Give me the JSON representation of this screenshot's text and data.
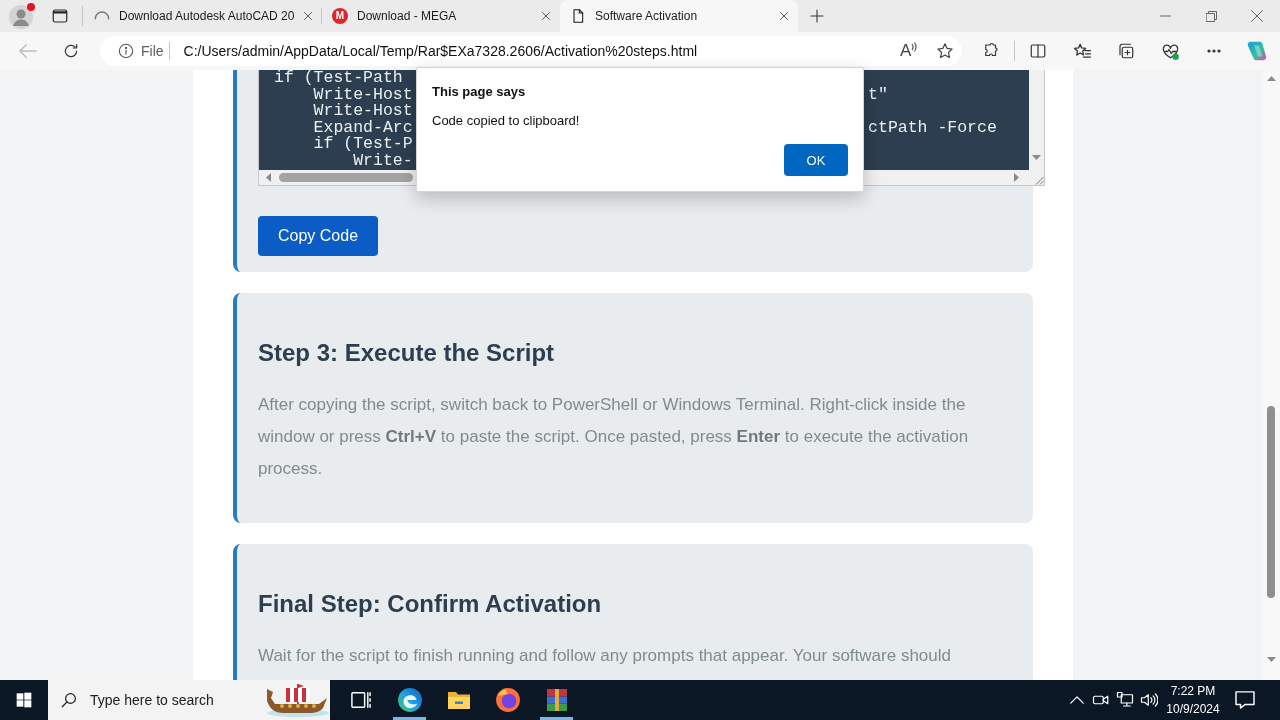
{
  "browser": {
    "tabs": [
      {
        "kind": "spinner",
        "title": "Download Autodesk AutoCAD 20",
        "selected": false
      },
      {
        "kind": "letter",
        "icon_letter": "M",
        "title": "Download - MEGA",
        "selected": false
      },
      {
        "kind": "page",
        "title": "Software Activation",
        "selected": true
      }
    ],
    "back_button": {
      "disabled": true
    },
    "address_bar": {
      "scheme": "File",
      "url": "C:/Users/admin/AppData/Local/Temp/Rar$EXa7328.2606/Activation%20steps.html",
      "read_aloud_glyph": "A"
    }
  },
  "page": {
    "code_block": {
      "lines": [
        {
          "text": "if (Test-Path"
        },
        {
          "text": "    Write-Host",
          "tail": "t\""
        },
        {
          "text": "    Write-Host"
        },
        {
          "text": "    Expand-Arc",
          "tail": "ctPath -Force"
        },
        {
          "text": "    if (Test-P"
        },
        {
          "text": "        Write-"
        }
      ]
    },
    "copy_button": "Copy Code",
    "steps": [
      {
        "heading": "Step 3: Execute the Script",
        "body": "After copying the script, switch back to PowerShell or Windows Terminal. Right-click inside the window or press **Ctrl+V** to paste the script. Once pasted, press **Enter** to execute the activation process."
      },
      {
        "heading": "Final Step: Confirm Activation",
        "body": "Wait for the script to finish running and follow any prompts that appear. Your software should"
      }
    ]
  },
  "dialog": {
    "title": "This page says",
    "message": "Code copied to clipboard!",
    "button": "OK"
  },
  "taskbar": {
    "search": {
      "placeholder": "Type here to search"
    },
    "apps": [
      {
        "kind": "edge",
        "running": true
      },
      {
        "kind": "explorer",
        "running": false
      },
      {
        "kind": "firefox",
        "running": false
      },
      {
        "kind": "winrar",
        "running": true
      }
    ],
    "clock": {
      "time": "7:22 PM",
      "date": "10/9/2024"
    }
  }
}
